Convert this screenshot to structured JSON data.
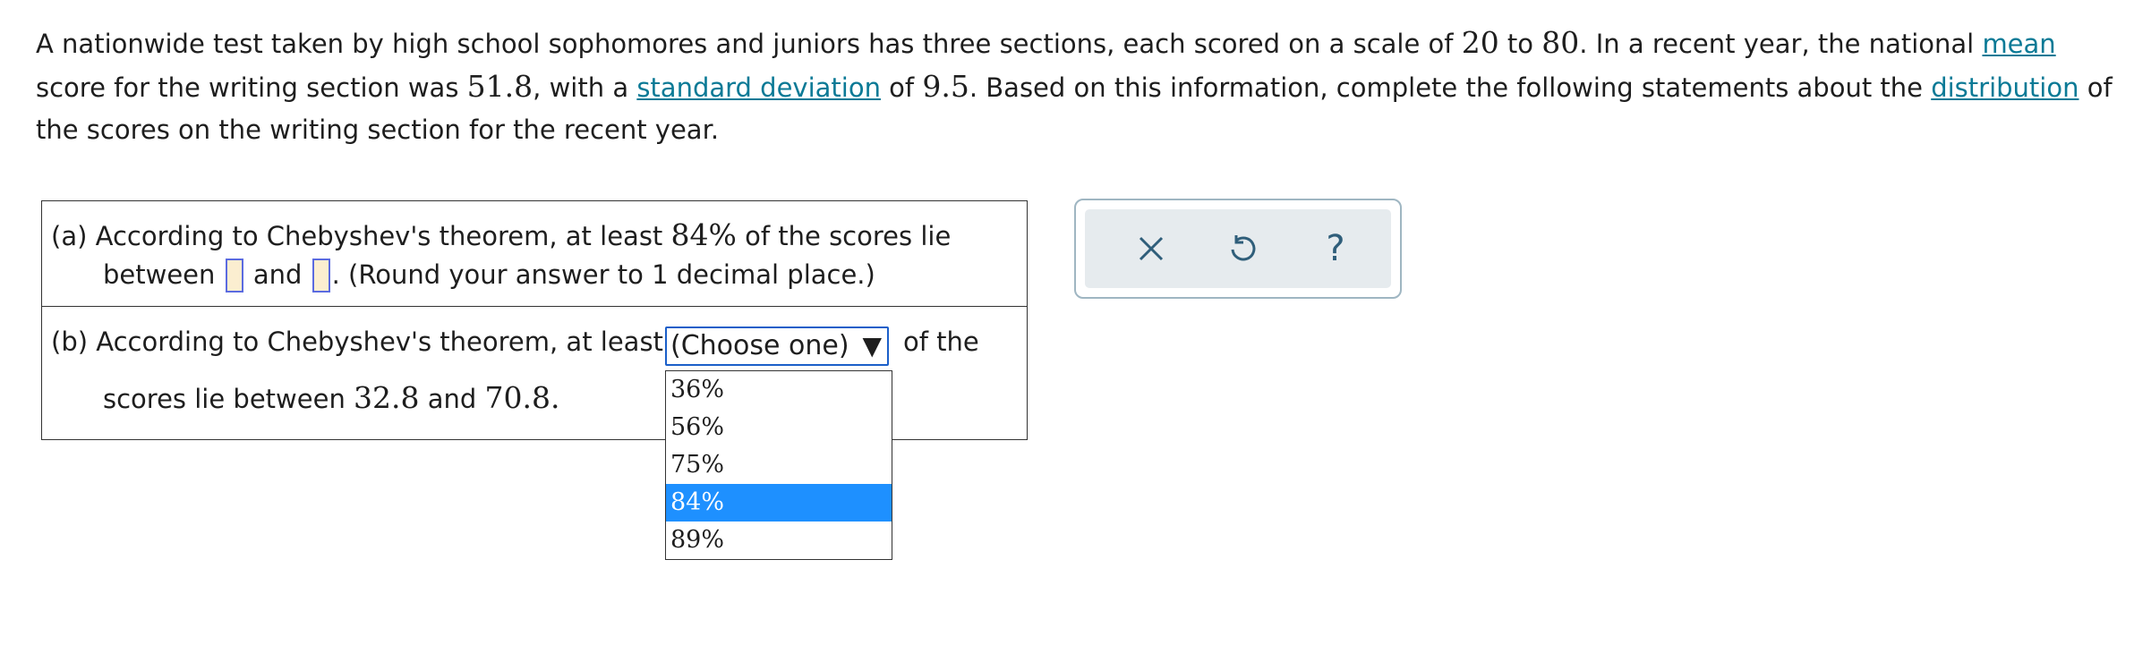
{
  "problem": {
    "t1": "A nationwide test taken by high school sophomores and juniors has three sections, each scored on a scale of ",
    "min": "20",
    "t2": " to ",
    "max": "80",
    "t3": ". In a recent year, the national ",
    "mean_link": "mean",
    "t4": " score for the writing section was ",
    "mean_value": "51.8",
    "t5": ", with a ",
    "sd_link": "standard deviation",
    "t6": " of ",
    "sd_value": "9.5",
    "t7": ". Based on this information, complete the following statements about the ",
    "dist_link": "distribution",
    "t8": " of the scores on the writing section for the recent year."
  },
  "part_a": {
    "label": "(a)",
    "text1": "According to Chebyshev's theorem, at least ",
    "pct": "84%",
    "text2": " of the scores lie",
    "between": "between",
    "and": "and",
    "round_note": ". (Round your answer to 1 decimal place.)"
  },
  "part_b": {
    "label": "(b)",
    "text1": "According to Chebyshev's theorem, at least",
    "text2": "of the",
    "text3": "scores lie between ",
    "low": "32.8",
    "and": " and ",
    "high": "70.8",
    "end": "."
  },
  "select": {
    "value": "(Choose one)",
    "options": [
      "36%",
      "56%",
      "75%",
      "84%",
      "89%"
    ],
    "highlighted": "84%"
  },
  "toolbar": {
    "icons": [
      "close-icon",
      "undo-icon",
      "help-icon"
    ],
    "help_glyph": "?"
  }
}
